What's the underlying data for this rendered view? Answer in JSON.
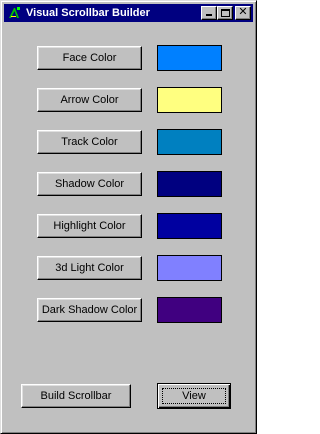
{
  "window": {
    "title": "Visual Scrollbar Builder"
  },
  "colors": [
    {
      "label": "Face Color",
      "value": "#0080ff"
    },
    {
      "label": "Arrow Color",
      "value": "#ffff80"
    },
    {
      "label": "Track Color",
      "value": "#0080c0"
    },
    {
      "label": "Shadow Color",
      "value": "#000080"
    },
    {
      "label": "Highlight Color",
      "value": "#0000a0"
    },
    {
      "label": "3d Light Color",
      "value": "#8080ff"
    },
    {
      "label": "Dark Shadow Color",
      "value": "#400080"
    }
  ],
  "actions": {
    "build_label": "Build Scrollbar",
    "view_label": "View"
  },
  "theme": {
    "face": "#c0c0c0",
    "title_bar": "#000080"
  }
}
